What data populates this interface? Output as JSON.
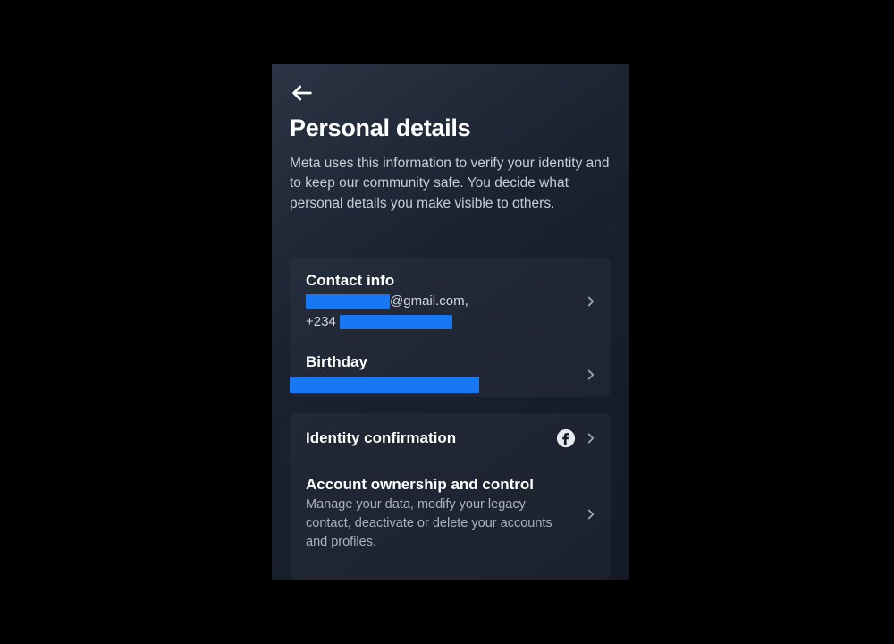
{
  "header": {
    "title": "Personal details",
    "subtitle": "Meta uses this information to verify your identity and to keep our community safe. You decide what personal details you make visible to others."
  },
  "contact": {
    "title": "Contact info",
    "email_suffix": "@gmail.com,",
    "phone_prefix": "+234"
  },
  "birthday": {
    "title": "Birthday"
  },
  "identity": {
    "title": "Identity confirmation"
  },
  "ownership": {
    "title": "Account ownership and control",
    "subtitle": "Manage your data, modify your legacy contact, deactivate or delete your accounts and profiles."
  }
}
